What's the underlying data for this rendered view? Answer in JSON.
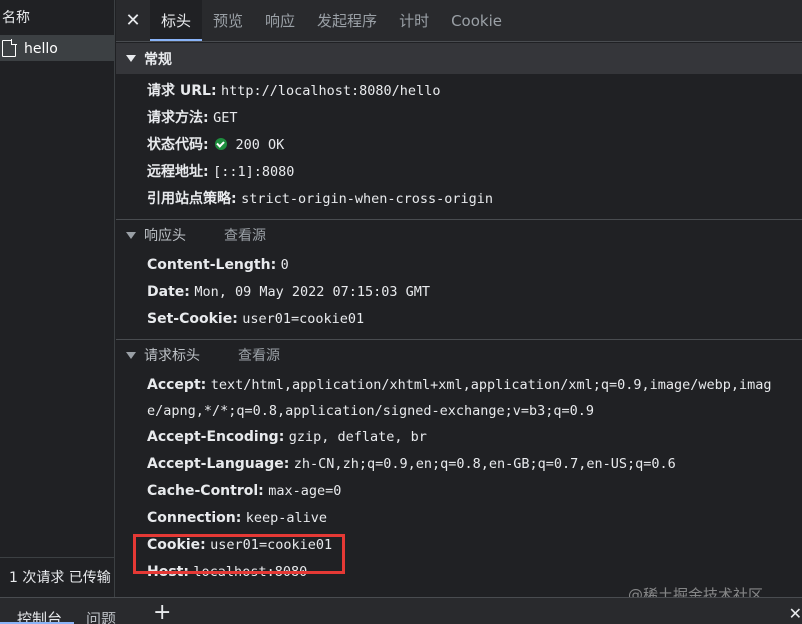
{
  "left": {
    "header": "名称",
    "request_name": "hello",
    "status": "1 次请求  已传输"
  },
  "tabs": {
    "close_icon": "close-icon",
    "items": [
      "标头",
      "预览",
      "响应",
      "发起程序",
      "计时",
      "Cookie"
    ],
    "active": "标头"
  },
  "general": {
    "title": "常规",
    "rows": [
      {
        "key": "请求 URL:",
        "value": "http://localhost:8080/hello"
      },
      {
        "key": "请求方法:",
        "value": "GET"
      },
      {
        "key": "状态代码:",
        "value": "200 OK"
      },
      {
        "key": "远程地址:",
        "value": "[::1]:8080"
      },
      {
        "key": "引用站点策略:",
        "value": "strict-origin-when-cross-origin"
      }
    ]
  },
  "response_headers": {
    "title": "响应头",
    "view_source": "查看源",
    "rows": [
      {
        "key": "Content-Length:",
        "value": "0"
      },
      {
        "key": "Date:",
        "value": "Mon, 09 May 2022 07:15:03 GMT"
      },
      {
        "key": "Set-Cookie:",
        "value": "user01=cookie01"
      }
    ]
  },
  "request_headers": {
    "title": "请求标头",
    "view_source": "查看源",
    "rows": [
      {
        "key": "Accept:",
        "value": "text/html,application/xhtml+xml,application/xml;q=0.9,image/webp,image/apng,*/*;q=0.8,application/signed-exchange;v=b3;q=0.9"
      },
      {
        "key": "Accept-Encoding:",
        "value": "gzip, deflate, br"
      },
      {
        "key": "Accept-Language:",
        "value": "zh-CN,zh;q=0.9,en;q=0.8,en-GB;q=0.7,en-US;q=0.6"
      },
      {
        "key": "Cache-Control:",
        "value": "max-age=0"
      },
      {
        "key": "Connection:",
        "value": "keep-alive"
      },
      {
        "key": "Cookie:",
        "value": "user01=cookie01"
      },
      {
        "key": "Host:",
        "value": "localhost:8080"
      }
    ]
  },
  "bottom": {
    "console": "控制台",
    "issues": "问题",
    "add": "+"
  },
  "watermark": "@稀土掘金技术社区",
  "colors": {
    "highlight": "#e53935",
    "status_ok": "#1e8e3e",
    "accent": "#8ab4f8"
  }
}
